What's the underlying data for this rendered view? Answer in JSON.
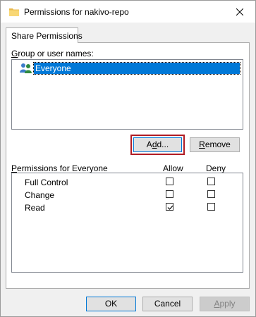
{
  "window": {
    "title": "Permissions for nakivo-repo",
    "icons": {
      "app": "folder-icon",
      "close": "close-icon"
    }
  },
  "tab": {
    "label": "Share Permissions"
  },
  "groups": {
    "label_prefix": "",
    "label_accel": "G",
    "label_rest": "roup or user names:",
    "items": [
      {
        "name": "Everyone",
        "icon": "users-group-icon",
        "selected": true
      }
    ]
  },
  "buttons": {
    "add_accel": "d",
    "add_prefix": "A",
    "add_rest": "d...",
    "remove_accel": "R",
    "remove_rest": "emove",
    "ok": "OK",
    "cancel": "Cancel",
    "apply_accel": "A",
    "apply_rest": "pply"
  },
  "permissions": {
    "header_accel": "P",
    "header_rest": "ermissions for Everyone",
    "allow_header": "Allow",
    "deny_header": "Deny",
    "rows": [
      {
        "name": "Full Control",
        "allow": false,
        "deny": false
      },
      {
        "name": "Change",
        "allow": false,
        "deny": false
      },
      {
        "name": "Read",
        "allow": true,
        "deny": false
      }
    ]
  },
  "colors": {
    "selection": "#0078d7",
    "focus_outline": "#b01c24"
  }
}
